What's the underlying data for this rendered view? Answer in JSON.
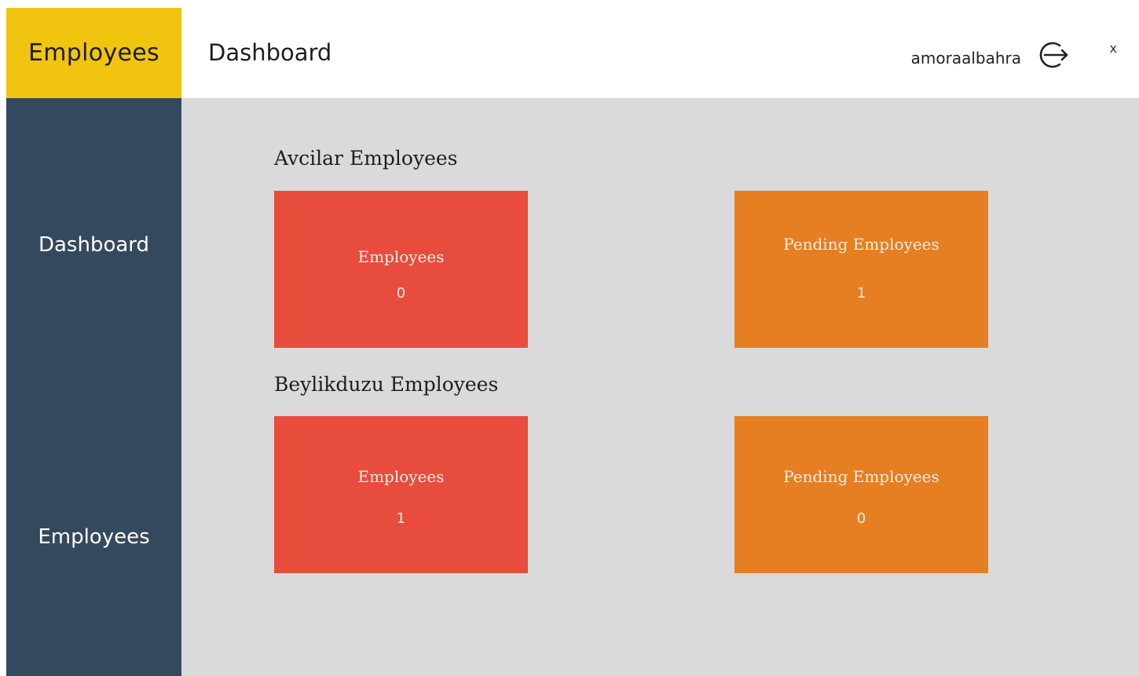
{
  "brand": {
    "title": "Employees",
    "color": "#f1c40f"
  },
  "header": {
    "page_title": "Dashboard",
    "username": "amoraalbahra",
    "logout_icon": "logout-icon",
    "close_label": "x"
  },
  "sidebar": {
    "background": "#34495e",
    "items": [
      {
        "label": "Dashboard"
      },
      {
        "label": "Employees"
      }
    ]
  },
  "sections": [
    {
      "title": "Avcilar Employees",
      "cards": [
        {
          "label": "Employees",
          "value": "0",
          "color": "#e74c3c"
        },
        {
          "label": "Pending Employees",
          "value": "1",
          "color": "#e67e22"
        }
      ]
    },
    {
      "title": "Beylikduzu Employees",
      "cards": [
        {
          "label": "Employees",
          "value": "1",
          "color": "#e74c3c"
        },
        {
          "label": "Pending Employees",
          "value": "0",
          "color": "#e67e22"
        }
      ]
    }
  ]
}
